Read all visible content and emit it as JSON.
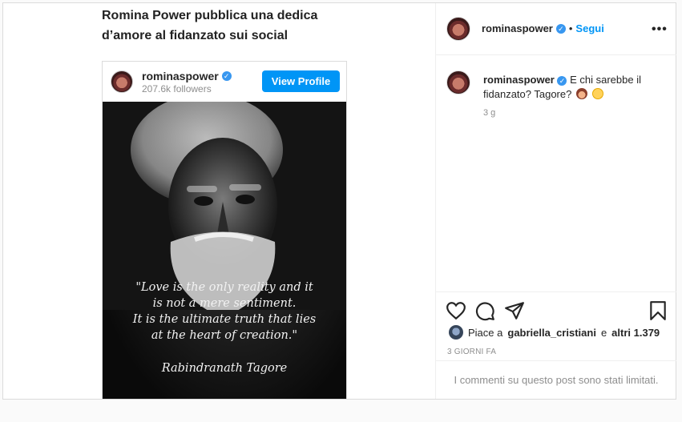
{
  "article": {
    "title_line1": "Romina Power pubblica una dedica",
    "title_line2": "d’amore al fidanzato sui social"
  },
  "embed": {
    "username": "rominaspower",
    "followers": "207.6k followers",
    "view_profile_label": "View Profile",
    "quote_lines": [
      "\"Love is the only reality and it",
      "is not a mere sentiment.",
      "It is the ultimate truth that lies",
      "at the heart of creation.\""
    ],
    "quote_author": "Rabindranath Tagore"
  },
  "header": {
    "username": "rominaspower",
    "separator": "•",
    "follow_label": "Segui",
    "more_label": "•••"
  },
  "comment": {
    "username": "rominaspower",
    "text": "E chi sarebbe il fidanzato? Tagore?",
    "time": "3 g"
  },
  "likes": {
    "prefix": "Piace a",
    "user": "gabriella_cristiani",
    "middle": "e",
    "others": "altri 1.379"
  },
  "post_date": "3 GIORNI FA",
  "comments_limited": "I commenti su questo post sono stati limitati.",
  "colors": {
    "accent": "#0095f6",
    "verified": "#3897f0",
    "muted_text": "#8e8e8e",
    "border": "#dbdbdb"
  },
  "icons": {
    "like": "heart-icon",
    "comment": "comment-icon",
    "share": "share-icon",
    "save": "bookmark-icon",
    "verified": "verified-badge-icon"
  }
}
